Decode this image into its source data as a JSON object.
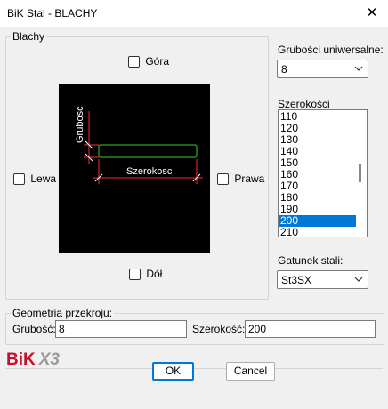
{
  "window": {
    "title": "BiK Stal - BLACHY",
    "close_glyph": "✕"
  },
  "blachy": {
    "legend": "Blachy",
    "gora": "Góra",
    "dol": "Dół",
    "lewa": "Lewa",
    "prawa": "Prawa",
    "dim_grubosc": "Grubosc",
    "dim_szerokosc": "Szerokosc"
  },
  "grubosci": {
    "label": "Grubości uniwersalne:",
    "value": "8"
  },
  "szerokosci": {
    "label": "Szerokości",
    "items": [
      "110",
      "120",
      "130",
      "140",
      "150",
      "160",
      "170",
      "180",
      "190",
      "200",
      "210"
    ],
    "selected": "200"
  },
  "gatunek": {
    "label": "Gatunek stali:",
    "value": "St3SX"
  },
  "geometria": {
    "legend": "Geometria przekroju:",
    "grubosc_label": "Grubość:",
    "grubosc_value": "8",
    "szerokosc_label": "Szerokość:",
    "szerokosc_value": "200"
  },
  "buttons": {
    "ok": "OK",
    "cancel": "Cancel"
  },
  "logo": {
    "text1": "BiK",
    "text2": "X3"
  },
  "colors": {
    "accent": "#0078d7",
    "logo_red": "#c8102e",
    "logo_gray": "#9a9a9a",
    "green": "#33cc33",
    "red": "#ff2a2a"
  }
}
